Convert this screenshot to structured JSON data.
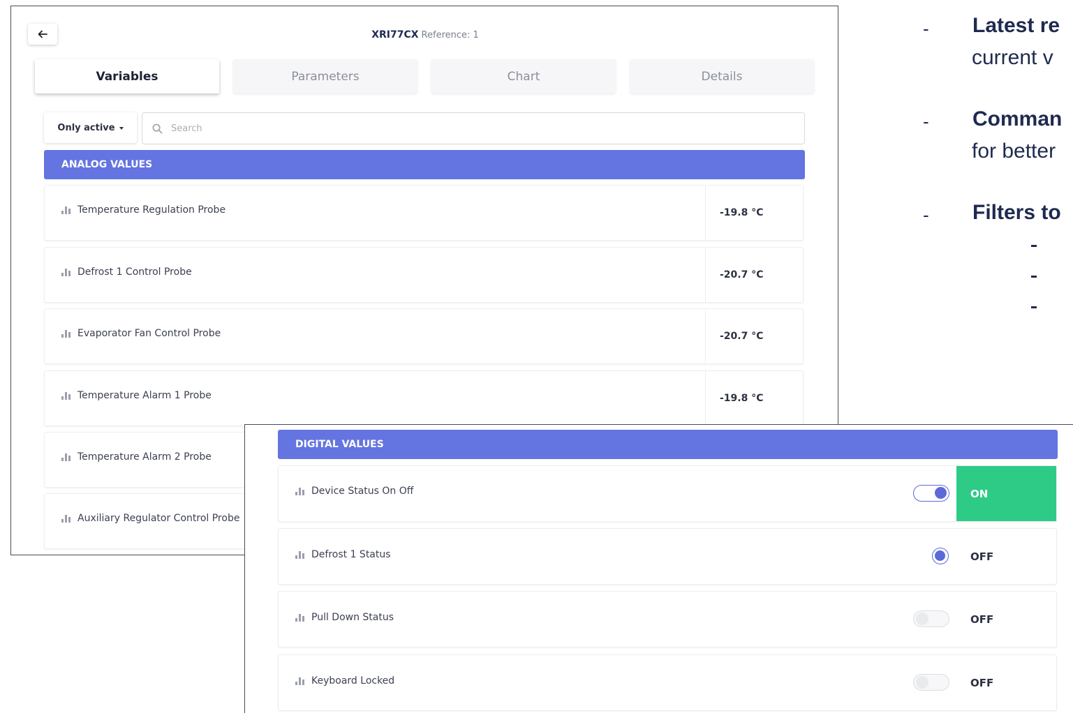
{
  "header": {
    "device_name": "XRI77CX",
    "reference": "Reference: 1"
  },
  "tabs": [
    {
      "label": "Variables",
      "active": true
    },
    {
      "label": "Parameters",
      "active": false
    },
    {
      "label": "Chart",
      "active": false
    },
    {
      "label": "Details",
      "active": false
    }
  ],
  "filter": {
    "label": "Only active"
  },
  "search": {
    "placeholder": "Search",
    "value": ""
  },
  "analog": {
    "title": "ANALOG VALUES",
    "rows": [
      {
        "label": "Temperature Regulation Probe",
        "value": "-19.8 °C"
      },
      {
        "label": "Defrost 1 Control Probe",
        "value": "-20.7 °C"
      },
      {
        "label": "Evaporator Fan Control Probe",
        "value": "-20.7 °C"
      },
      {
        "label": "Temperature Alarm 1 Probe",
        "value": "-19.8 °C"
      },
      {
        "label": "Temperature Alarm 2 Probe",
        "value": ""
      },
      {
        "label": "Auxiliary Regulator Control Probe",
        "value": ""
      }
    ]
  },
  "digital": {
    "title": "DIGITAL VALUES",
    "rows": [
      {
        "label": "Device Status On Off",
        "value": "ON",
        "control": "toggle-on"
      },
      {
        "label": "Defrost 1 Status",
        "value": "OFF",
        "control": "radio-on"
      },
      {
        "label": "Pull Down Status",
        "value": "OFF",
        "control": "toggle-off"
      },
      {
        "label": "Keyboard Locked",
        "value": "OFF",
        "control": "toggle-off"
      }
    ]
  },
  "notes": [
    {
      "bold": "Latest re",
      "line2": "current v"
    },
    {
      "bold": "Comman",
      "line2": "for better"
    },
    {
      "bold": "Filters to",
      "line2": ""
    }
  ],
  "colors": {
    "section_bar": "#6474e0",
    "on_green": "#2ecb87",
    "toggle_accent": "#5c6ad8"
  },
  "icons": [
    "back-arrow-icon",
    "search-icon",
    "bar-chart-icon",
    "dropdown-caret-icon"
  ]
}
